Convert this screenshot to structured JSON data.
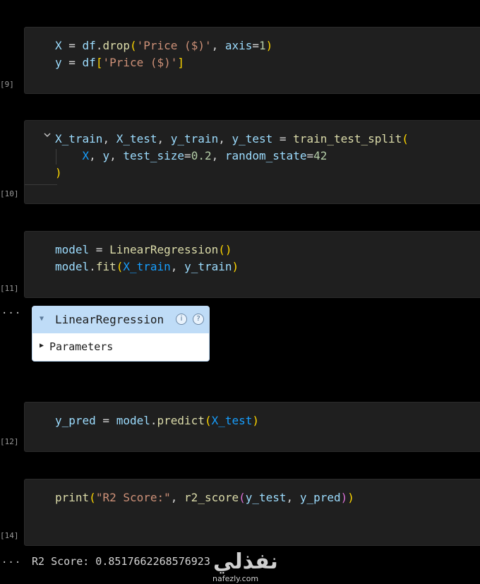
{
  "cells": [
    {
      "exec_label": "[9]",
      "lines": [
        [
          {
            "t": "X",
            "c": "v"
          },
          {
            "t": " = ",
            "c": "o"
          },
          {
            "t": "df",
            "c": "v"
          },
          {
            "t": ".",
            "c": "o"
          },
          {
            "t": "drop",
            "c": "f"
          },
          {
            "t": "(",
            "c": "b1"
          },
          {
            "t": "'Price ($)'",
            "c": "s"
          },
          {
            "t": ", ",
            "c": "o"
          },
          {
            "t": "axis",
            "c": "v"
          },
          {
            "t": "=",
            "c": "o"
          },
          {
            "t": "1",
            "c": "n"
          },
          {
            "t": ")",
            "c": "b1"
          }
        ],
        [
          {
            "t": "y",
            "c": "v"
          },
          {
            "t": " = ",
            "c": "o"
          },
          {
            "t": "df",
            "c": "v"
          },
          {
            "t": "[",
            "c": "b1"
          },
          {
            "t": "'Price ($)'",
            "c": "s"
          },
          {
            "t": "]",
            "c": "b1"
          }
        ]
      ]
    },
    {
      "exec_label": "[10]",
      "lines": [
        [
          {
            "t": "X_train",
            "c": "v"
          },
          {
            "t": ", ",
            "c": "o"
          },
          {
            "t": "X_test",
            "c": "v"
          },
          {
            "t": ", ",
            "c": "o"
          },
          {
            "t": "y_train",
            "c": "v"
          },
          {
            "t": ", ",
            "c": "o"
          },
          {
            "t": "y_test",
            "c": "v"
          },
          {
            "t": " = ",
            "c": "o"
          },
          {
            "t": "train_test_split",
            "c": "f"
          },
          {
            "t": "(",
            "c": "b1"
          }
        ],
        [
          {
            "t": "    ",
            "c": "o"
          },
          {
            "t": "X",
            "c": "b3"
          },
          {
            "t": ", ",
            "c": "o"
          },
          {
            "t": "y",
            "c": "v"
          },
          {
            "t": ", ",
            "c": "o"
          },
          {
            "t": "test_size",
            "c": "v"
          },
          {
            "t": "=",
            "c": "o"
          },
          {
            "t": "0.2",
            "c": "n"
          },
          {
            "t": ", ",
            "c": "o"
          },
          {
            "t": "random_state",
            "c": "v"
          },
          {
            "t": "=",
            "c": "o"
          },
          {
            "t": "42",
            "c": "n"
          }
        ],
        [
          {
            "t": ")",
            "c": "b1"
          }
        ]
      ]
    },
    {
      "exec_label": "[11]",
      "lines": [
        [
          {
            "t": "model",
            "c": "v"
          },
          {
            "t": " = ",
            "c": "o"
          },
          {
            "t": "LinearRegression",
            "c": "f"
          },
          {
            "t": "()",
            "c": "b1"
          }
        ],
        [
          {
            "t": "model",
            "c": "v"
          },
          {
            "t": ".",
            "c": "o"
          },
          {
            "t": "fit",
            "c": "f"
          },
          {
            "t": "(",
            "c": "b1"
          },
          {
            "t": "X_train",
            "c": "b3"
          },
          {
            "t": ", ",
            "c": "o"
          },
          {
            "t": "y_train",
            "c": "v"
          },
          {
            "t": ")",
            "c": "b1"
          }
        ]
      ]
    },
    {
      "exec_label": "[12]",
      "lines": [
        [
          {
            "t": "y_pred",
            "c": "v"
          },
          {
            "t": " = ",
            "c": "o"
          },
          {
            "t": "model",
            "c": "v"
          },
          {
            "t": ".",
            "c": "o"
          },
          {
            "t": "predict",
            "c": "f"
          },
          {
            "t": "(",
            "c": "b1"
          },
          {
            "t": "X_test",
            "c": "b3"
          },
          {
            "t": ")",
            "c": "b1"
          }
        ]
      ]
    },
    {
      "exec_label": "[14]",
      "lines": [
        [
          {
            "t": "print",
            "c": "f"
          },
          {
            "t": "(",
            "c": "b1"
          },
          {
            "t": "\"R2 Score:\"",
            "c": "s"
          },
          {
            "t": ", ",
            "c": "o"
          },
          {
            "t": "r2_score",
            "c": "f"
          },
          {
            "t": "(",
            "c": "b2"
          },
          {
            "t": "y_test",
            "c": "v"
          },
          {
            "t": ", ",
            "c": "o"
          },
          {
            "t": "y_pred",
            "c": "v"
          },
          {
            "t": ")",
            "c": "b2"
          },
          {
            "t": ")",
            "c": "b1"
          }
        ]
      ]
    }
  ],
  "ellipsis": "...",
  "widget": {
    "title": "LinearRegression",
    "info_badge": "i",
    "help_badge": "?",
    "section_label": "Parameters"
  },
  "output_text": "R2 Score: 0.8517662268576923",
  "watermark": {
    "arabic": "نفذلي",
    "latin": "nafezly.com"
  },
  "icons": {
    "fold": "chevron-down-icon",
    "collapse": "triangle-down-icon",
    "expand": "triangle-right-icon"
  }
}
